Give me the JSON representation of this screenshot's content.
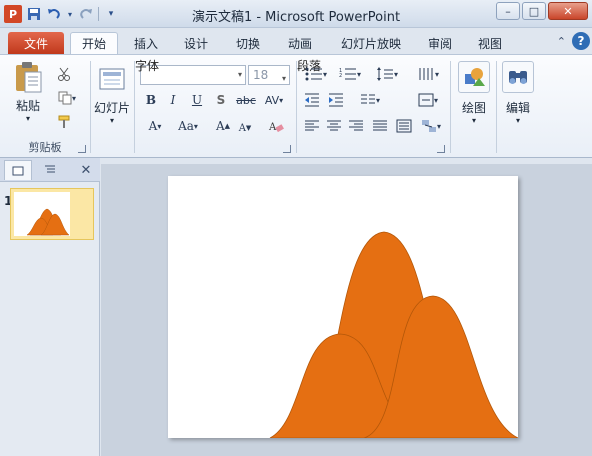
{
  "window": {
    "title": "演示文稿1  -  Microsoft PowerPoint",
    "logo_letter": "P",
    "controls": {
      "minimize": "–",
      "maximize": "□",
      "close": "✕"
    }
  },
  "quick_access": {
    "save_icon": "save-icon",
    "undo_icon": "undo-icon",
    "redo_icon": "redo-icon",
    "customize_icon": "dropdown-icon"
  },
  "tabs": [
    {
      "label": "文件"
    },
    {
      "label": "开始"
    },
    {
      "label": "插入"
    },
    {
      "label": "设计"
    },
    {
      "label": "切换"
    },
    {
      "label": "动画"
    },
    {
      "label": "幻灯片放映"
    },
    {
      "label": "审阅"
    },
    {
      "label": "视图"
    }
  ],
  "ribbon": {
    "clipboard": {
      "label": "剪贴板",
      "paste_label": "粘贴"
    },
    "slides": {
      "new_slide_label": "幻灯片"
    },
    "font": {
      "label": "字体",
      "font_name": "",
      "font_size": "18",
      "bold": "B",
      "italic": "I",
      "underline": "U",
      "shadow": "S",
      "strike": "abc",
      "spacing": "AV",
      "font_color": "A",
      "change_case": "Aa",
      "grow": "A",
      "shrink": "A"
    },
    "paragraph": {
      "label": "段落"
    },
    "drawing": {
      "label": "绘图"
    },
    "editing": {
      "label": "编辑"
    }
  },
  "slides_panel": {
    "slides": [
      {
        "number": "1"
      }
    ]
  },
  "colors": {
    "shape_fill": "#e56f12",
    "shape_stroke": "#b35709",
    "file_tab": "#c9411f"
  }
}
